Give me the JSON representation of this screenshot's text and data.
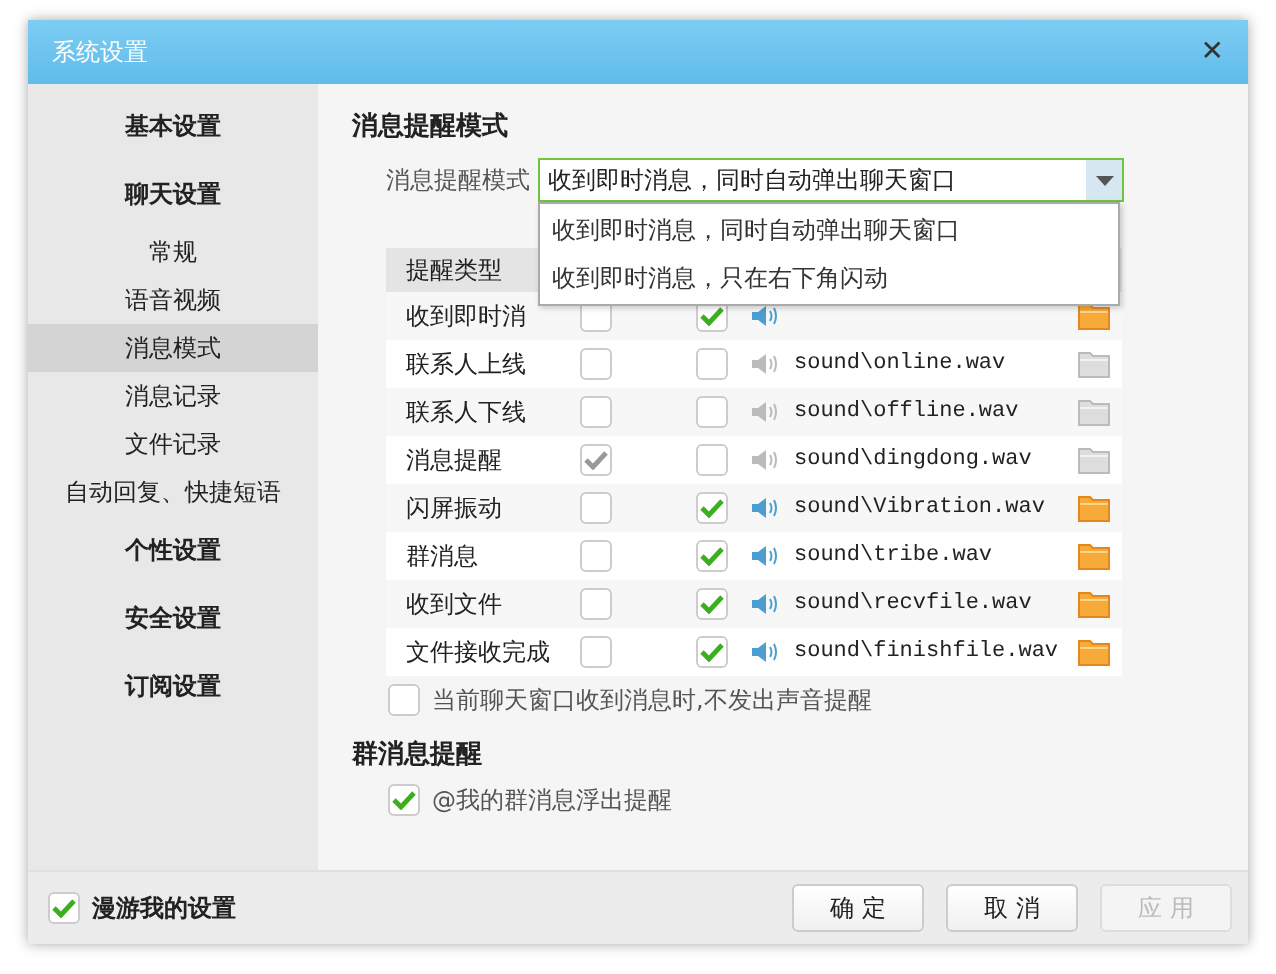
{
  "window": {
    "title": "系统设置",
    "close": "✕"
  },
  "sidebar": {
    "items": [
      {
        "label": "基本设置",
        "kind": "group",
        "selected": false
      },
      {
        "label": "聊天设置",
        "kind": "group",
        "selected": false
      },
      {
        "label": "常规",
        "kind": "sub",
        "selected": false
      },
      {
        "label": "语音视频",
        "kind": "sub",
        "selected": false
      },
      {
        "label": "消息模式",
        "kind": "sub",
        "selected": true
      },
      {
        "label": "消息记录",
        "kind": "sub",
        "selected": false
      },
      {
        "label": "文件记录",
        "kind": "sub",
        "selected": false
      },
      {
        "label": "自动回复、快捷短语",
        "kind": "sub",
        "selected": false
      },
      {
        "label": "个性设置",
        "kind": "group",
        "selected": false
      },
      {
        "label": "安全设置",
        "kind": "group",
        "selected": false
      },
      {
        "label": "订阅设置",
        "kind": "group",
        "selected": false
      }
    ]
  },
  "section_title": "消息提醒模式",
  "mode": {
    "label": "消息提醒模式",
    "value": "收到即时消息，同时自动弹出聊天窗口",
    "expanded": true,
    "options": [
      {
        "label": "收到即时消息，同时自动弹出聊天窗口"
      },
      {
        "label": "收到即时消息，只在右下角闪动"
      }
    ]
  },
  "table": {
    "columns": [
      "提醒类型"
    ],
    "rows": [
      {
        "name": "收到即时消",
        "popup_checked": false,
        "sound_checked": true
      },
      {
        "name": "联系人上线",
        "popup_checked": false,
        "sound_checked": false,
        "file": "sound\\online.wav"
      },
      {
        "name": "联系人下线",
        "popup_checked": false,
        "sound_checked": false,
        "file": "sound\\offline.wav"
      },
      {
        "name": "消息提醒",
        "popup_checked": true,
        "popup_disabled": true,
        "sound_checked": false,
        "file": "sound\\dingdong.wav"
      },
      {
        "name": "闪屏振动",
        "popup_checked": false,
        "sound_checked": true,
        "file": "sound\\Vibration.wav"
      },
      {
        "name": "群消息",
        "popup_checked": false,
        "sound_checked": true,
        "file": "sound\\tribe.wav"
      },
      {
        "name": "收到文件",
        "popup_checked": false,
        "sound_checked": true,
        "file": "sound\\recvfile.wav"
      },
      {
        "name": "文件接收完成",
        "popup_checked": false,
        "sound_checked": true,
        "file": "sound\\finishfile.wav"
      }
    ]
  },
  "mute_option": {
    "label": "当前聊天窗口收到消息时,不发出声音提醒",
    "checked": false
  },
  "group_section_title": "群消息提醒",
  "group_option": {
    "label": "@我的群消息浮出提醒",
    "checked": true
  },
  "roam": {
    "label": "漫游我的设置",
    "checked": true
  },
  "buttons": [
    {
      "label": "确 定",
      "disabled": false
    },
    {
      "label": "取 消",
      "disabled": false
    },
    {
      "label": "应 用",
      "disabled": true
    }
  ]
}
